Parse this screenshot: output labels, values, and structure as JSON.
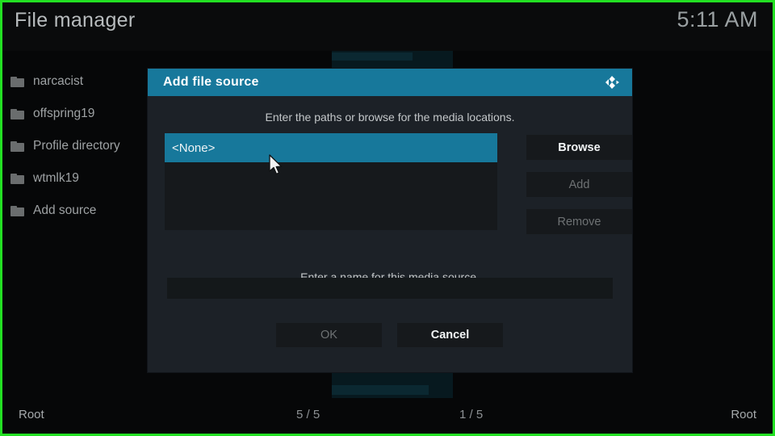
{
  "app": {
    "title": "File manager",
    "clock": "5:11 AM"
  },
  "colors": {
    "accent": "#17789b",
    "capture_border": "#23e023",
    "dialog_bg": "#1c2127",
    "button_bg": "#16191c",
    "text_primary": "#c3c7c9",
    "text_disabled": "#6e7274"
  },
  "filelist": {
    "items": [
      {
        "icon": "folder-icon",
        "label": "narcacist"
      },
      {
        "icon": "folder-icon",
        "label": "offspring19"
      },
      {
        "icon": "folder-icon",
        "label": "Profile directory"
      },
      {
        "icon": "folder-icon",
        "label": "wtmlk19"
      },
      {
        "icon": "folder-icon",
        "label": "Add source"
      }
    ]
  },
  "dialog": {
    "title": "Add file source",
    "logo_icon": "kodi-logo-icon",
    "hint_paths": "Enter the paths or browse for the media locations.",
    "hint_name": "Enter a name for this media source.",
    "path_list": {
      "selected": "<None>",
      "items": [
        "<None>"
      ]
    },
    "side_buttons": [
      {
        "label": "Browse",
        "enabled": true
      },
      {
        "label": "Add",
        "enabled": false
      },
      {
        "label": "Remove",
        "enabled": false
      }
    ],
    "name_field": {
      "value": "",
      "placeholder": ""
    },
    "main_buttons": [
      {
        "label": "OK",
        "enabled": false
      },
      {
        "label": "Cancel",
        "enabled": true
      }
    ]
  },
  "statusbar": {
    "left_path": "Root",
    "left_count": "5 / 5",
    "right_count": "1 / 5",
    "right_path": "Root"
  }
}
